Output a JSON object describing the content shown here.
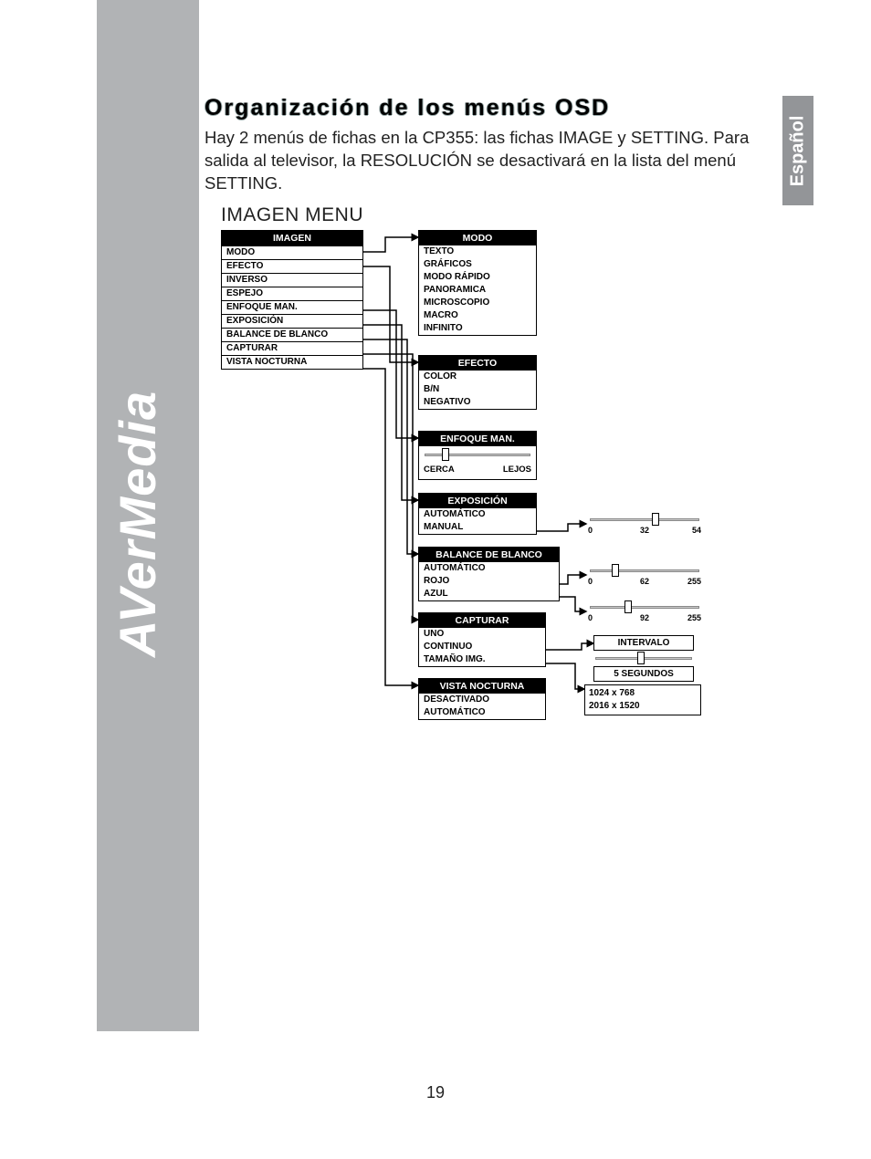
{
  "lang_tab": "Español",
  "brand": {
    "part1": "AVer",
    "part2": "Media"
  },
  "heading": "Organización de los menús OSD",
  "intro": "Hay 2 menús de fichas en la CP355: las fichas IMAGE y SETTING. Para salida al televisor, la RESOLUCIÓN se desactivará en la lista del menú SETTING.",
  "section_title": "IMAGEN MENU",
  "page_number": "19",
  "imagen": {
    "header": "IMAGEN",
    "items": [
      "MODO",
      "EFECTO",
      "INVERSO",
      "ESPEJO",
      "ENFOQUE MAN.",
      "EXPOSICIÓN",
      "BALANCE DE BLANCO",
      "CAPTURAR",
      "VISTA NOCTURNA"
    ]
  },
  "modo": {
    "header": "MODO",
    "items": [
      "TEXTO",
      "GRÁFICOS",
      "MODO RÁPIDO",
      "PANORAMICA",
      "MICROSCOPIO",
      "MACRO",
      "INFINITO"
    ]
  },
  "efecto": {
    "header": "EFECTO",
    "items": [
      "COLOR",
      "B/N",
      "NEGATIVO"
    ]
  },
  "enfoque": {
    "header": "ENFOQUE MAN.",
    "left": "CERCA",
    "right": "LEJOS"
  },
  "exposicion": {
    "header": "EXPOSICIÓN",
    "items": [
      "AUTOMÁTICO",
      "MANUAL"
    ]
  },
  "balance": {
    "header": "BALANCE DE BLANCO",
    "items": [
      "AUTOMÁTICO",
      "ROJO",
      "AZUL"
    ]
  },
  "capturar": {
    "header": "CAPTURAR",
    "items": [
      "UNO",
      "CONTINUO",
      "TAMAÑO IMG."
    ]
  },
  "vista": {
    "header": "VISTA NOCTURNA",
    "items": [
      "DESACTIVADO",
      "AUTOMÁTICO"
    ]
  },
  "slider_expo": {
    "min": "0",
    "mid": "32",
    "max": "54"
  },
  "slider_rojo": {
    "min": "0",
    "mid": "62",
    "max": "255"
  },
  "slider_azul": {
    "min": "0",
    "mid": "92",
    "max": "255"
  },
  "intervalo": {
    "header": "INTERVALO",
    "value": "5 SEGUNDOS"
  },
  "tamano": {
    "line1": "1024  x   768",
    "line2": "2016  x  1520"
  }
}
